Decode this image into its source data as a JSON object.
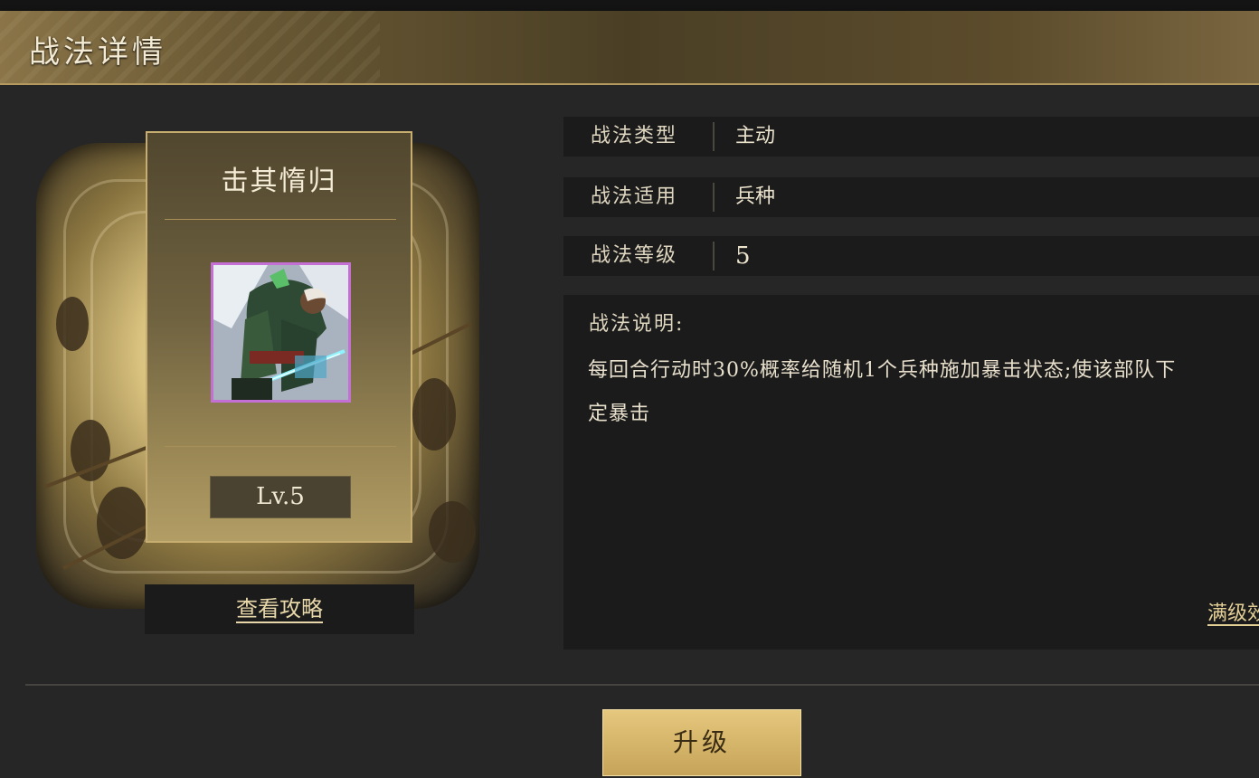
{
  "header": {
    "title": "战法详情"
  },
  "card": {
    "name": "击其惰归",
    "level": "Lv.5",
    "portrait_icon": "warrior-portrait-icon",
    "frame_color": "#c36fd3"
  },
  "guide_link": "查看攻略",
  "info": {
    "rows": [
      {
        "label": "战法类型",
        "value": "主动"
      },
      {
        "label": "战法适用",
        "value": "兵种"
      },
      {
        "label": "战法等级",
        "value": "5"
      }
    ],
    "description_title": "战法说明:",
    "description_lines": [
      "每回合行动时30%概率给随机1个兵种施加暴击状态;使该部队下",
      "定暴击"
    ],
    "max_level_link": "满级效果"
  },
  "upgrade_button": "升级",
  "colors": {
    "accent_gold": "#d4b468",
    "panel_bg": "#1b1b1b",
    "rare_purple": "#c36fd3"
  }
}
